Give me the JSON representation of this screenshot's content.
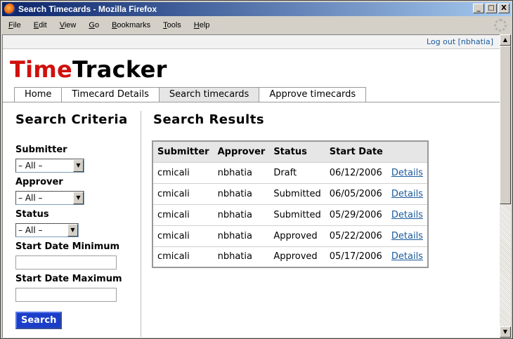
{
  "window": {
    "title": "Search Timecards - Mozilla Firefox",
    "buttons": {
      "minimize": "_",
      "maximize": "□",
      "close": "X"
    }
  },
  "menu": [
    {
      "underline": "F",
      "rest": "ile"
    },
    {
      "underline": "E",
      "rest": "dit"
    },
    {
      "underline": "V",
      "rest": "iew"
    },
    {
      "underline": "G",
      "rest": "o"
    },
    {
      "underline": "B",
      "rest": "ookmarks"
    },
    {
      "underline": "T",
      "rest": "ools"
    },
    {
      "underline": "H",
      "rest": "elp"
    }
  ],
  "header": {
    "logout": "Log out [nbhatia]",
    "logo_part1": "Time",
    "logo_part2": "Tracker",
    "logo_colors": {
      "part1": "#d0100c",
      "part2": "#000000"
    }
  },
  "tabs": [
    {
      "label": "Home",
      "active": false
    },
    {
      "label": "Timecard Details",
      "active": false
    },
    {
      "label": "Search timecards",
      "active": true
    },
    {
      "label": "Approve timecards",
      "active": false
    }
  ],
  "sidebar": {
    "title": "Search Criteria",
    "submitter_label": "Submitter",
    "submitter_value": "– All –",
    "approver_label": "Approver",
    "approver_value": "– All –",
    "status_label": "Status",
    "status_value": "– All –",
    "start_min_label": "Start Date Minimum",
    "start_min_value": "",
    "start_max_label": "Start Date Maximum",
    "start_max_value": "",
    "search_button": "Search",
    "search_button_color": "#1a3ec8"
  },
  "results": {
    "title": "Search Results",
    "columns": [
      "Submitter",
      "Approver",
      "Status",
      "Start Date",
      ""
    ],
    "rows": [
      [
        "cmicali",
        "nbhatia",
        "Draft",
        "06/12/2006",
        "Details"
      ],
      [
        "cmicali",
        "nbhatia",
        "Submitted",
        "06/05/2006",
        "Details"
      ],
      [
        "cmicali",
        "nbhatia",
        "Submitted",
        "05/29/2006",
        "Details"
      ],
      [
        "cmicali",
        "nbhatia",
        "Approved",
        "05/22/2006",
        "Details"
      ],
      [
        "cmicali",
        "nbhatia",
        "Approved",
        "05/17/2006",
        "Details"
      ]
    ]
  },
  "icons": {
    "app": "firefox-icon",
    "select_arrow": "▼",
    "scroll_up": "▲",
    "scroll_down": "▼"
  }
}
